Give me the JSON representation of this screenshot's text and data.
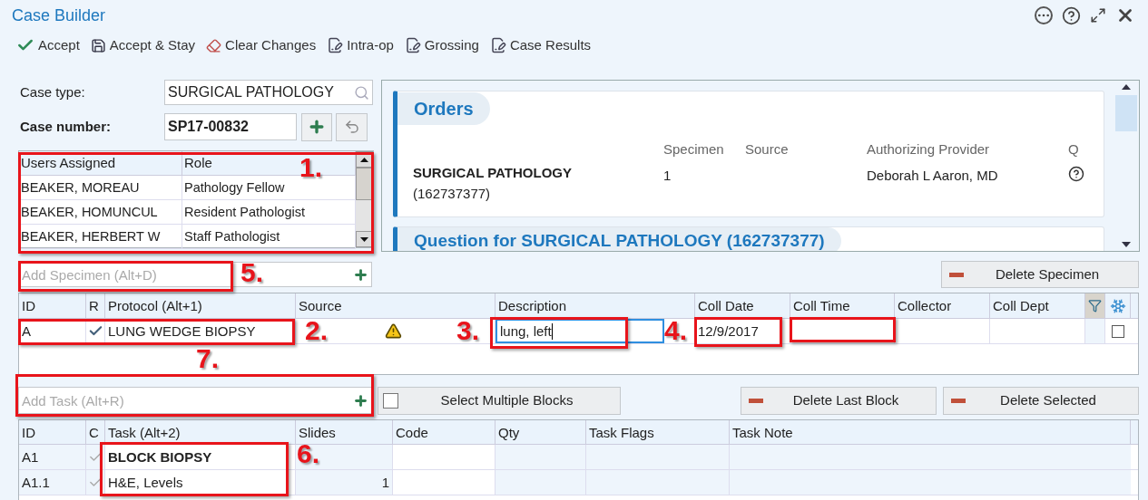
{
  "window": {
    "title": "Case Builder"
  },
  "toolbar": [
    {
      "label": "Accept",
      "kind": "check"
    },
    {
      "label": "Accept & Stay",
      "kind": "save"
    },
    {
      "label": "Clear Changes",
      "kind": "eraser"
    },
    {
      "label": "Intra-op",
      "kind": "document"
    },
    {
      "label": "Grossing",
      "kind": "document"
    },
    {
      "label": "Case Results",
      "kind": "document"
    }
  ],
  "case_type": {
    "label": "Case type:",
    "value": "SURGICAL PATHOLOGY"
  },
  "case_number": {
    "label": "Case number:",
    "value": "SP17-00832"
  },
  "users": {
    "columns": [
      "Users Assigned",
      "Role"
    ],
    "rows": [
      [
        "BEAKER, MOREAU",
        "Pathology Fellow"
      ],
      [
        "BEAKER, HOMUNCUL",
        "Resident Pathologist"
      ],
      [
        "BEAKER, HERBERT W",
        "Staff Pathologist"
      ]
    ]
  },
  "orders": {
    "title": "Orders",
    "columns": [
      "Specimen",
      "Source",
      "Authorizing Provider",
      "Q"
    ],
    "name": "SURGICAL PATHOLOGY",
    "number": "(162737377)",
    "specimen": "1",
    "provider": "Deborah L Aaron, MD",
    "next_section": "Question for SURGICAL PATHOLOGY (162737377)"
  },
  "add_specimen": {
    "placeholder": "Add Specimen (Alt+D)"
  },
  "delete_specimen": "Delete Specimen",
  "specimens": {
    "columns": [
      "ID",
      "R",
      "Protocol (Alt+1)",
      "Source",
      "Description",
      "Coll Date",
      "Coll Time",
      "Collector",
      "Coll Dept"
    ],
    "rows": [
      {
        "id": "A",
        "required": true,
        "protocol": "LUNG WEDGE BIOPSY",
        "warning": true,
        "description": "lung, left",
        "coll_date": "12/9/2017",
        "checked": false
      }
    ]
  },
  "add_task": {
    "placeholder": "Add Task (Alt+R)"
  },
  "select_multiple": {
    "label": "Select Multiple Blocks",
    "checked": false
  },
  "task_buttons": [
    "Delete Last Block",
    "Delete Selected"
  ],
  "tasks": {
    "columns": [
      "ID",
      "C",
      "Task (Alt+2)",
      "Slides",
      "Code",
      "Qty",
      "Task Flags",
      "Task Note"
    ],
    "rows": [
      {
        "id": "A1",
        "complete": true,
        "task": "BLOCK BIOPSY",
        "kind": "block"
      },
      {
        "id": "A1.1",
        "complete": true,
        "task": "H&E, Levels",
        "kind": "slide",
        "slides": "1"
      }
    ]
  },
  "annotations": [
    {
      "label": "1."
    },
    {
      "label": "2."
    },
    {
      "label": "3."
    },
    {
      "label": "4."
    },
    {
      "label": "5."
    },
    {
      "label": "6."
    },
    {
      "label": "7."
    },
    {
      "kind": "box"
    }
  ]
}
